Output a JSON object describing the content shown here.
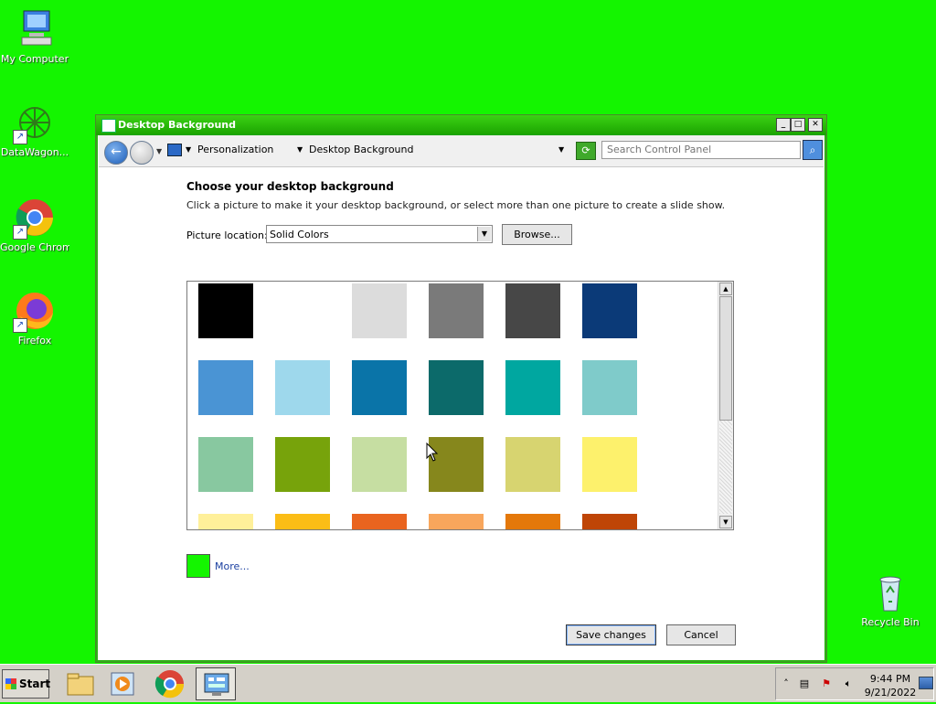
{
  "desktop": {
    "icons": [
      {
        "label": "My Computer"
      },
      {
        "label": "DataWagon..."
      },
      {
        "label": "Google Chrome"
      },
      {
        "label": "Firefox"
      },
      {
        "label": "Recycle Bin"
      }
    ]
  },
  "window": {
    "title": "Desktop Background",
    "breadcrumb": [
      "Personalization",
      "Desktop Background"
    ],
    "search_placeholder": "Search Control Panel",
    "heading": "Choose your desktop background",
    "subtext": "Click a picture to make it your desktop background, or select more than one picture to create a slide show.",
    "location_label": "Picture location:",
    "location_value": "Solid Colors",
    "browse_label": "Browse...",
    "swatches": [
      "#000000",
      "#ffffff",
      "#dcdcdc",
      "#7a7a7a",
      "#474747",
      "#0b3a78",
      "#4a94d4",
      "#9ed8ec",
      "#0a74a8",
      "#0c6a6a",
      "#00a7a0",
      "#7fcbca",
      "#88c8a0",
      "#77a30b",
      "#c6dea2",
      "#86871c",
      "#d7d470",
      "#fdf16c",
      "#fff09a",
      "#fbbd16",
      "#e9641f",
      "#f8a65c",
      "#e4780a",
      "#bf4506"
    ],
    "more_color": "#14f500",
    "more_label": "More...",
    "save_label": "Save changes",
    "cancel_label": "Cancel"
  },
  "taskbar": {
    "start_label": "Start",
    "time": "9:44 PM",
    "date": "9/21/2022"
  }
}
